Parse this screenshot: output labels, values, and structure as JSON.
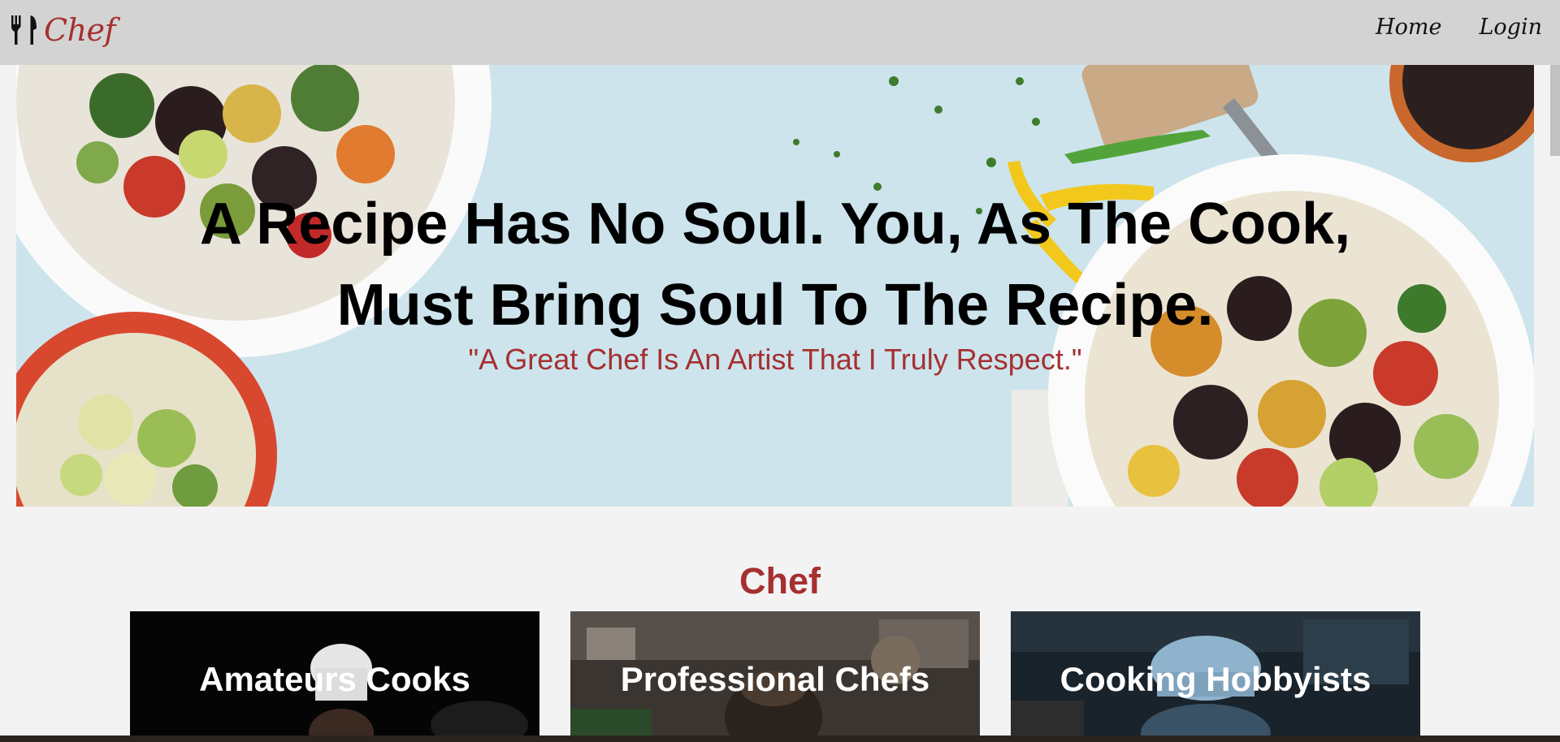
{
  "navbar": {
    "brand_name": "Chef",
    "brand_icon": "fork-knife-icon",
    "links": [
      "Home",
      "Login"
    ]
  },
  "hero": {
    "title_line1": "A Recipe Has No Soul. You, As The Cook,",
    "title_line2": "Must Bring Soul To The Recipe.",
    "quote": "\"A Great Chef Is An Artist That I Truly Respect.\""
  },
  "section": {
    "title": "Chef"
  },
  "cards": [
    {
      "label": "Amateurs Cooks"
    },
    {
      "label": "Professional Chefs"
    },
    {
      "label": "Cooking Hobbyists"
    }
  ],
  "colors": {
    "accent": "#a53030",
    "navbar_bg": "#d3d3d3",
    "hero_bg": "#cde5ee",
    "page_bg": "#f3f3f3"
  }
}
